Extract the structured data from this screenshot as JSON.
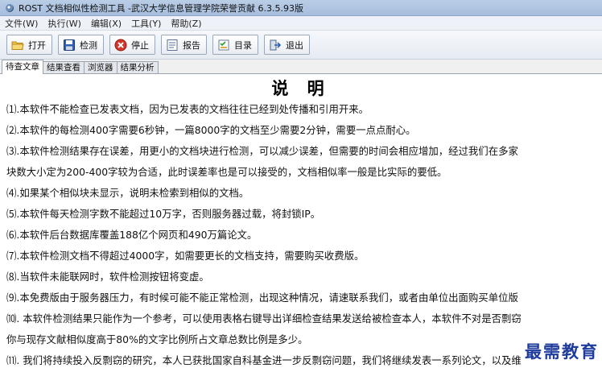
{
  "window": {
    "title": "ROST 文档相似性检测工具 -武汉大学信息管理学院荣誉贡献 6.3.5.93版"
  },
  "menu": [
    "文件(W)",
    "执行(W)",
    "编辑(X)",
    "工具(Y)",
    "帮助(Z)"
  ],
  "toolbar": {
    "open": "打开",
    "check": "检测",
    "stop": "停止",
    "report": "报告",
    "catalog": "目录",
    "exit": "退出"
  },
  "tabs": [
    "待查文章",
    "结果查看",
    "浏览器",
    "结果分析"
  ],
  "document": {
    "title": "说 明",
    "lines": [
      "⑴.本软件不能检查已发表文档，因为已发表的文档往往已经到处传播和引用开来。",
      "⑵.本软件的每检测400字需要6秒钟，一篇8000字的文档至少需要2分钟，需要一点点耐心。",
      "⑶.本软件检测结果存在误差，用更小的文档块进行检测，可以减少误差，但需要的时间会相应增加，经过我们在多家",
      "块数大小定为200-400字较为合适，此时误差率也是可以接受的，文档相似率一般是比实际的要低。",
      "⑷.如果某个相似块未显示，说明未检索到相似的文档。",
      "⑸.本软件每天检测字数不能超过10万字，否则服务器过载，将封锁IP。",
      "⑹.本软件后台数据库覆盖188亿个网页和490万篇论文。",
      "⑺.本软件检测文档不得超过4000字，如需要更长的文档支持，需要购买收费版。",
      "⑻.当软件未能联网时，软件检测按钮将变虚。",
      "⑼.本免费版由于服务器压力，有时候可能不能正常检测，出现这种情况，请速联系我们，或者由单位出面购买单位版",
      "⑽. 本软件检测结果只能作为一个参考，可以使用表格右键导出详细检查结果发送给被检查本人，本软件不对是否剽窃",
      "你与现存文献相似度高于80%的文字比例所占文章总数比例是多少。",
      "⑾. 我们将持续投入反剽窃的研究，本人已获批国家自科基金进一步反剽窃问题，我们将继续发表一系列论文，以及维"
    ]
  },
  "watermark": "最需教育"
}
